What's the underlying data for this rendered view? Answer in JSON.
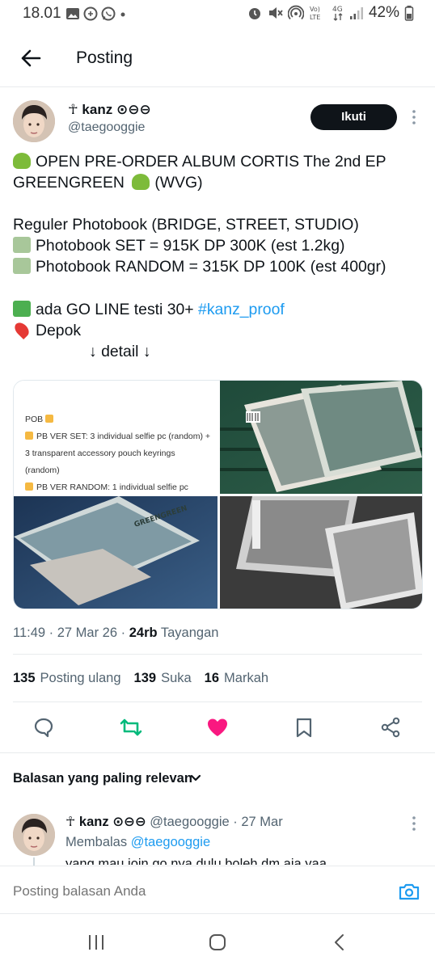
{
  "status_bar": {
    "time": "18.01",
    "battery": "42%",
    "network_label": "4G",
    "volte_label": "Vo) LTE"
  },
  "header": {
    "title": "Posting",
    "back_icon": "arrow-left-icon"
  },
  "post": {
    "author_name": "kanz",
    "author_name_prefix_symbol": "☥",
    "author_name_suffix": "⊙⊖⊖",
    "author_handle": "@taegooggie",
    "follow_label": "Ikuti",
    "lines": [
      "OPEN PRE-ORDER ALBUM CORTIS The 2nd EP",
      "GREENGREEN",
      "(WVG)",
      "Reguler Photobook (BRIDGE, STREET, STUDIO)",
      "Photobook SET = 915K DP 300K (est 1.2kg)",
      "Photobook RANDOM = 315K DP 100K (est 400gr)",
      "ada GO LINE testi 30+",
      "#kanz_proof",
      "Depok",
      "↓ detail ↓"
    ],
    "media": {
      "pob_title": "POB",
      "pob_set_text": "PB VER SET: 3 individual selfie pc (random) + 3 transparent accessory pouch keyrings (random)",
      "pob_random_text": "PB VER RANDOM: 1 individual selfie pc",
      "album_text": "GREENGREEN"
    },
    "meta": {
      "time": "11:49",
      "date": "27 Mar 26",
      "views_count": "24rb",
      "views_label": "Tayangan"
    },
    "stats": {
      "reposts_count": "135",
      "reposts_label": "Posting ulang",
      "likes_count": "139",
      "likes_label": "Suka",
      "bookmarks_count": "16",
      "bookmarks_label": "Markah"
    },
    "colors": {
      "retweet": "#00ba7c",
      "like": "#f91880",
      "link": "#1d9bf0"
    }
  },
  "replies": {
    "sort_label": "Balasan yang paling relevan",
    "reply": {
      "author_name": "kanz",
      "author_name_prefix_symbol": "☥",
      "author_name_suffix": "⊙⊖⊖",
      "handle": "@taegooggie",
      "date": "27 Mar",
      "replying_to_label": "Membalas",
      "replying_to_handle": "@taegooggie",
      "text": "yang mau join go nya dulu boleh dm aja yaa"
    }
  },
  "composer": {
    "placeholder": "Posting balasan Anda"
  }
}
